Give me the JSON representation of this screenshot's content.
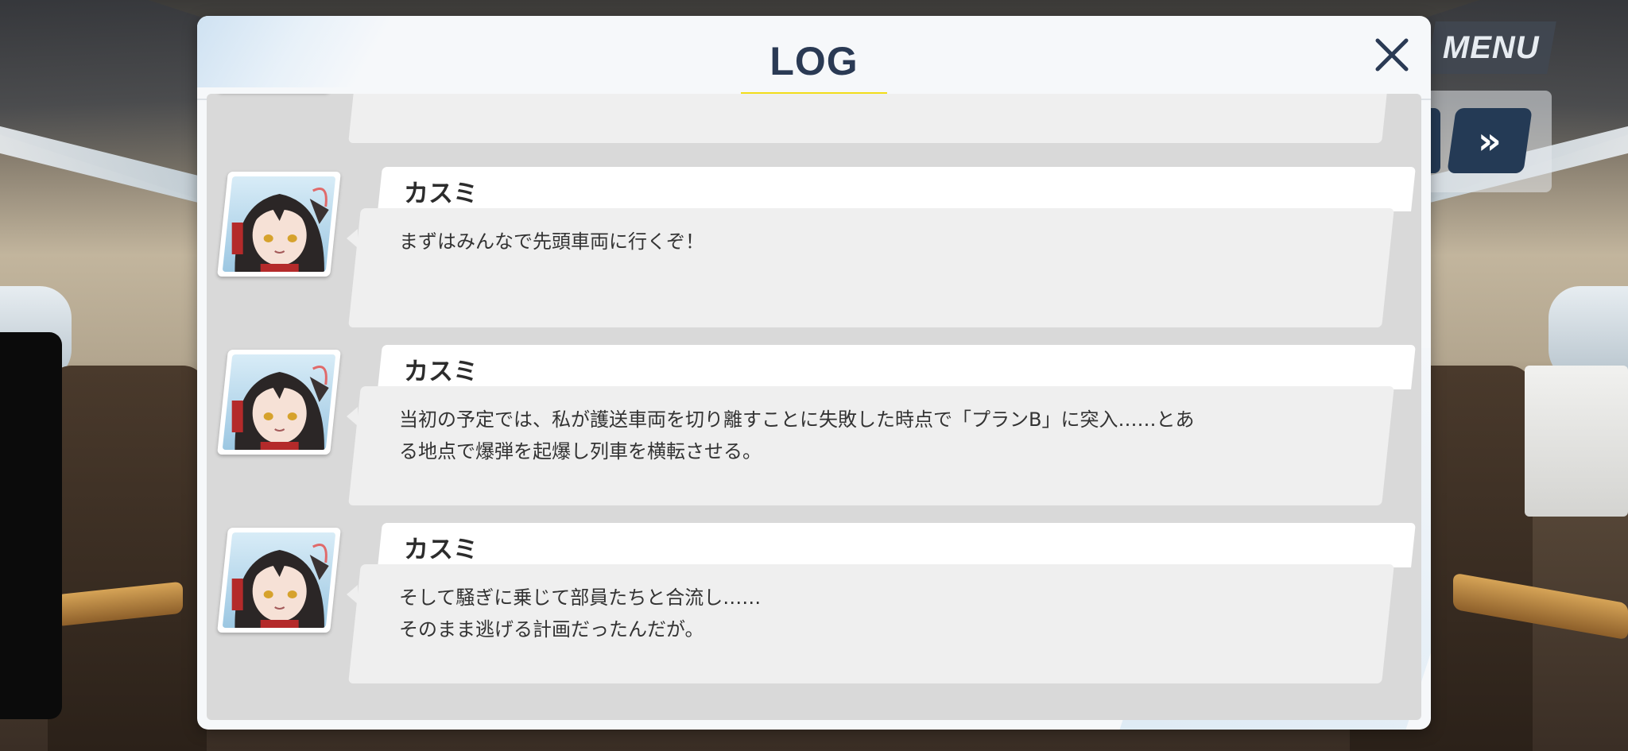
{
  "hud": {
    "menu_label": "MENU",
    "fast_forward_glyph": "»"
  },
  "dialog": {
    "title": "LOG",
    "close_glyph": "✕"
  },
  "log": {
    "entries": [
      {
        "speaker": "",
        "text": ""
      },
      {
        "speaker": "カスミ",
        "text": "まずはみんなで先頭車両に行くぞ！"
      },
      {
        "speaker": "カスミ",
        "text": "当初の予定では、私が護送車両を切り離すことに失敗した時点で「プランB」に突入……とあ\nる地点で爆弾を起爆し列車を横転させる。"
      },
      {
        "speaker": "カスミ",
        "text": "そして騒ぎに乗じて部員たちと合流し……\nそのまま逃げる計画だったんだが。"
      }
    ]
  },
  "colors": {
    "title": "#2a3a54",
    "underline": "#f2dd1a",
    "hud_button": "#243a55",
    "bubble": "#efefef"
  }
}
